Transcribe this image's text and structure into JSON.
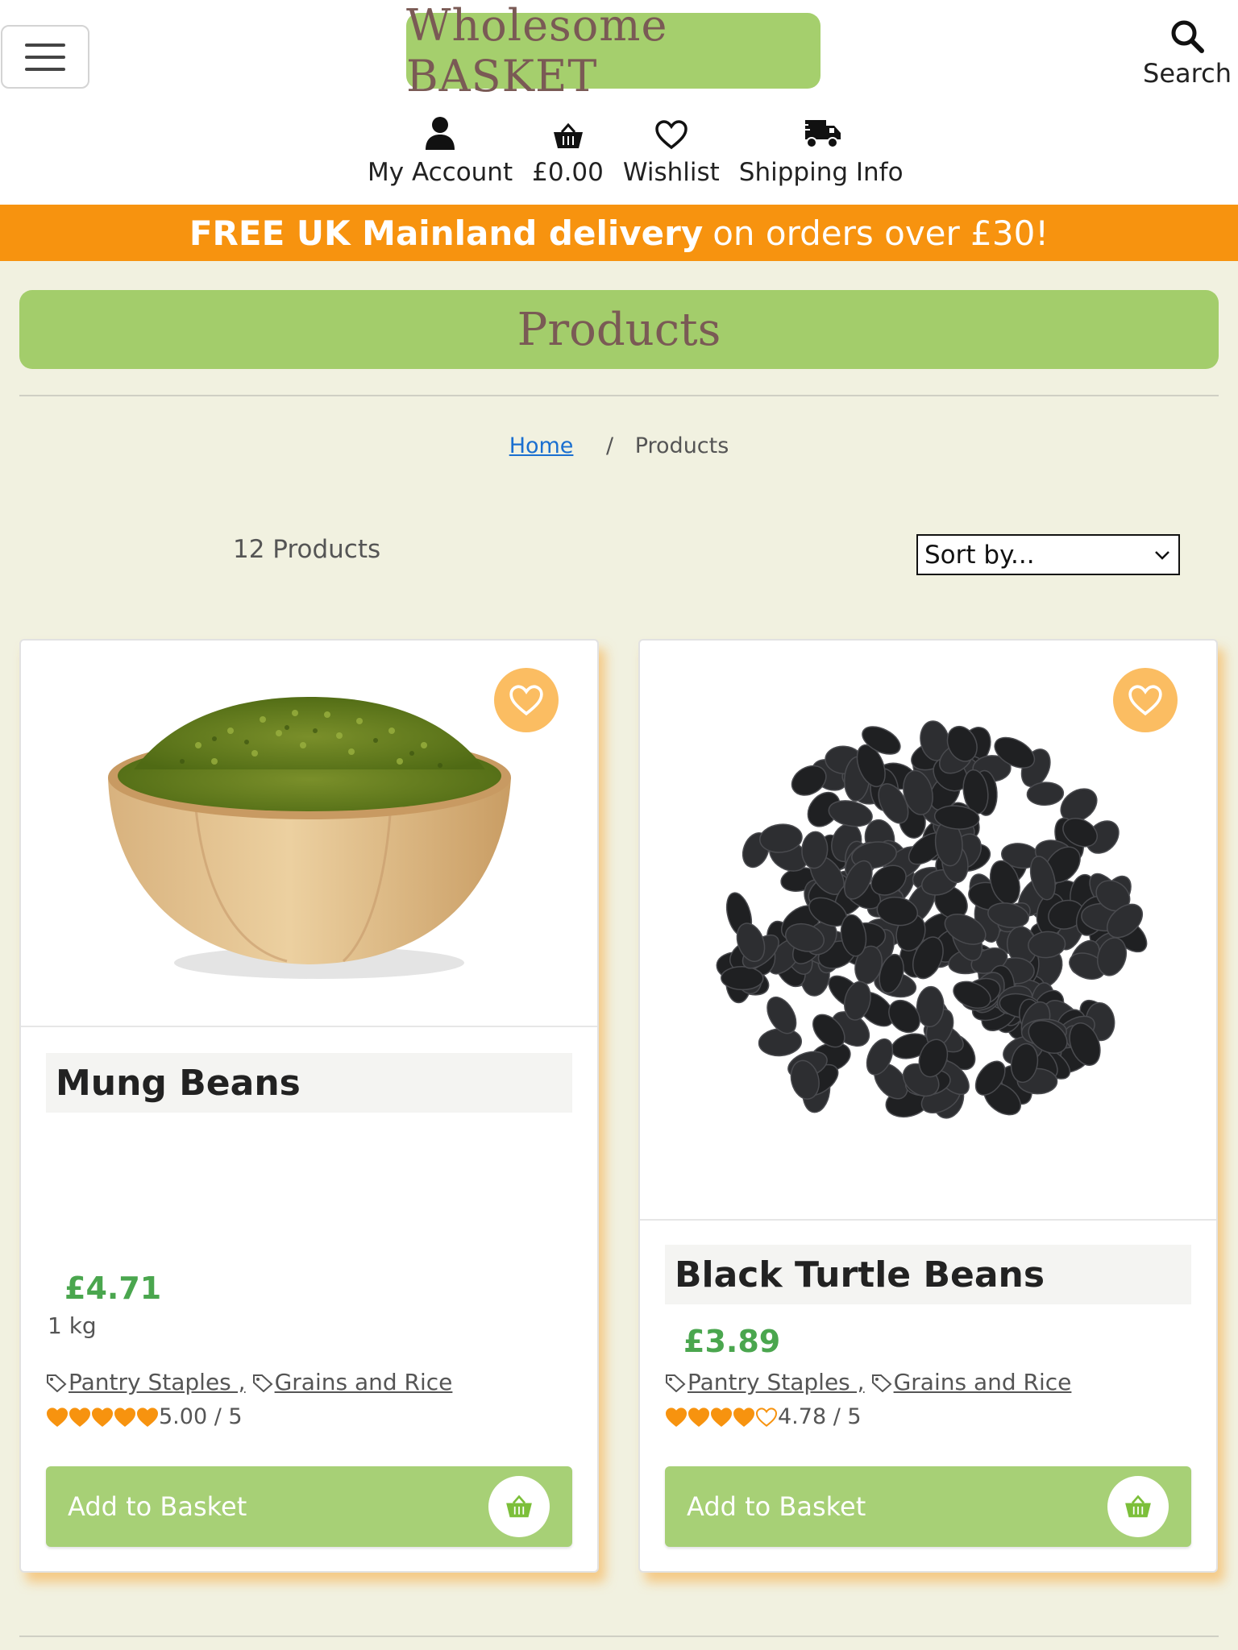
{
  "header": {
    "logo_text": "Wholesome BASKET",
    "search_label": "Search",
    "nav": [
      {
        "label": "My Account",
        "icon": "user-icon"
      },
      {
        "label": "£0.00",
        "icon": "basket-icon"
      },
      {
        "label": "Wishlist",
        "icon": "heart-icon"
      },
      {
        "label": "Shipping Info",
        "icon": "truck-icon"
      }
    ]
  },
  "banner": {
    "bold": "FREE UK Mainland delivery",
    "rest": "on orders over £30!",
    "color": "#f7930f"
  },
  "page": {
    "title": "Products",
    "breadcrumb_home": "Home",
    "breadcrumb_sep": "/",
    "breadcrumb_current": "Products",
    "count": "12 Products",
    "sort_value": "Sort by..."
  },
  "products": [
    {
      "name": "Mung Beans",
      "price": "£4.71",
      "weight": "1 kg",
      "tag1": "Pantry Staples ,",
      "tag2": "Grains and Rice",
      "rating_text": "5.00 / 5",
      "rating_value": 5.0,
      "add_label": "Add to Basket"
    },
    {
      "name": "Black Turtle Beans",
      "price": "£3.89",
      "weight": "",
      "tag1": "Pantry Staples ,",
      "tag2": "Grains and Rice",
      "rating_text": "4.78 / 5",
      "rating_value": 4.78,
      "add_label": "Add to Basket"
    }
  ],
  "colors": {
    "brand_green": "#a3cd6b",
    "price_green": "#4aa64e",
    "accent_orange": "#f7930f",
    "logo_text": "#7a5a55"
  }
}
